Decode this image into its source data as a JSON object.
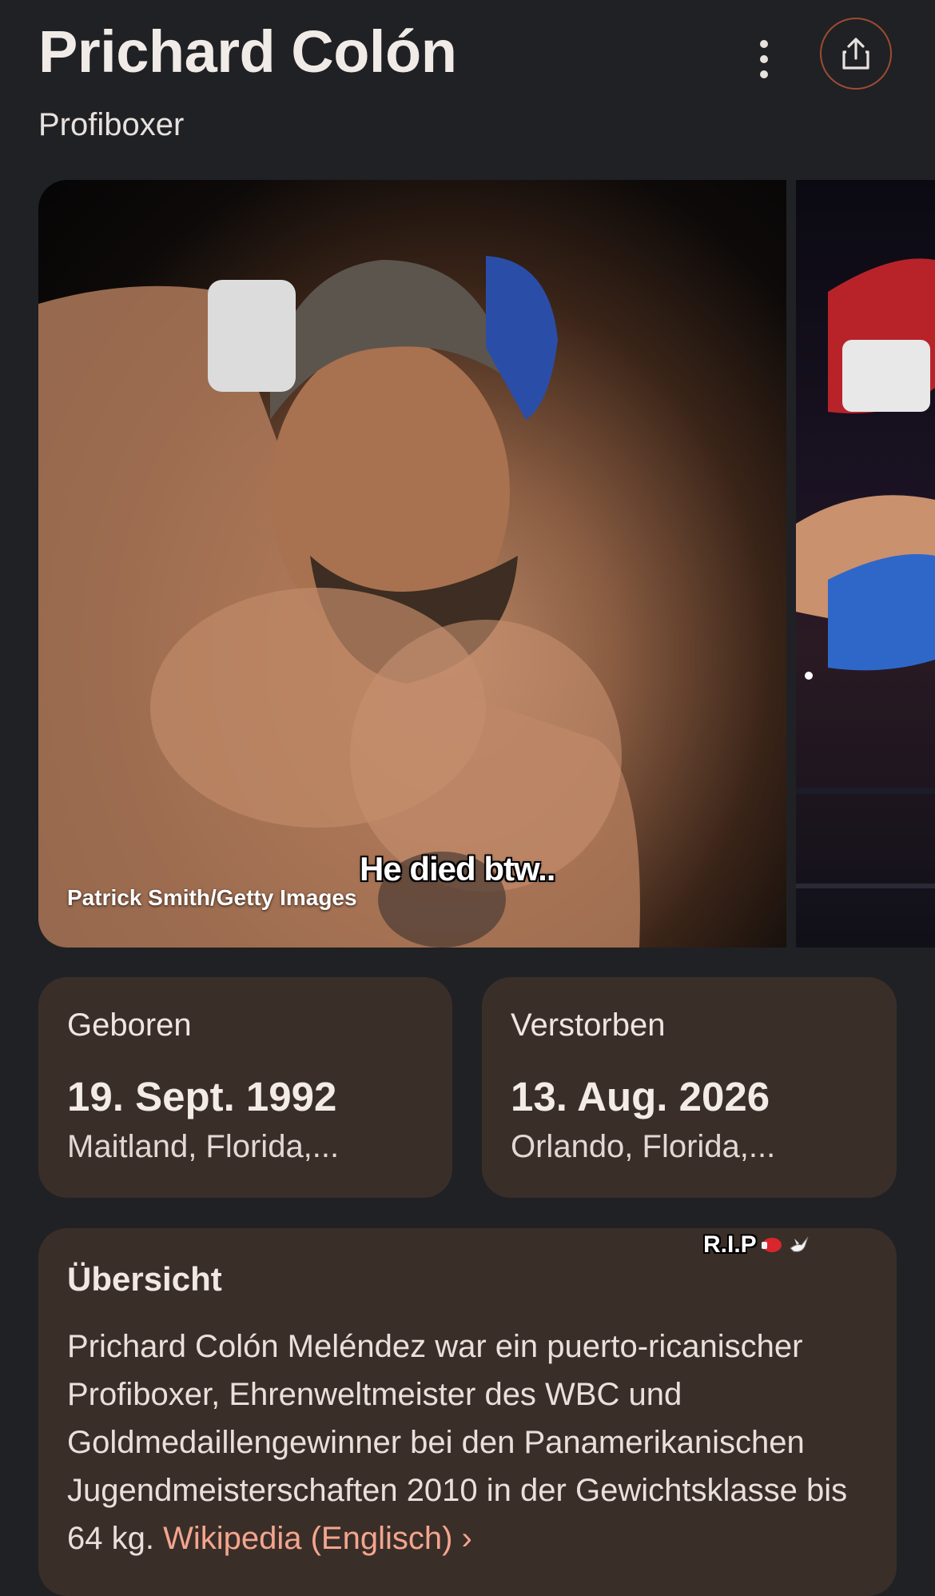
{
  "header": {
    "title": "Prichard Colón",
    "subtitle": "Profiboxer",
    "more_icon": "more-vert-icon",
    "share_icon": "share-icon"
  },
  "gallery": {
    "photo_credit": "Patrick Smith/Getty Images",
    "overlay_caption": "He died btw.."
  },
  "facts": {
    "born": {
      "label": "Geboren",
      "date": "19. Sept. 1992",
      "place": "Maitland, Florida,..."
    },
    "died": {
      "label": "Verstorben",
      "date": "13. Aug. 2026",
      "place": "Orlando, Florida,..."
    }
  },
  "overview": {
    "heading": "Übersicht",
    "text": "Prichard Colón Meléndez war ein puerto-ricanischer Profiboxer, Ehrenweltmeister des WBC und Goldmedaillengewinner bei den Panamerikanischen Jugendmeisterschaften 2010 in der Gewichtsklasse bis 64 kg. ",
    "link_label": "Wikipedia (Englisch)",
    "link_chevron": "›"
  },
  "overlay": {
    "rip_text": "R.I.P"
  },
  "colors": {
    "background": "#202124",
    "card": "#3a2e29",
    "accent_link": "#f4a58e",
    "share_ring": "#9c4b33"
  }
}
